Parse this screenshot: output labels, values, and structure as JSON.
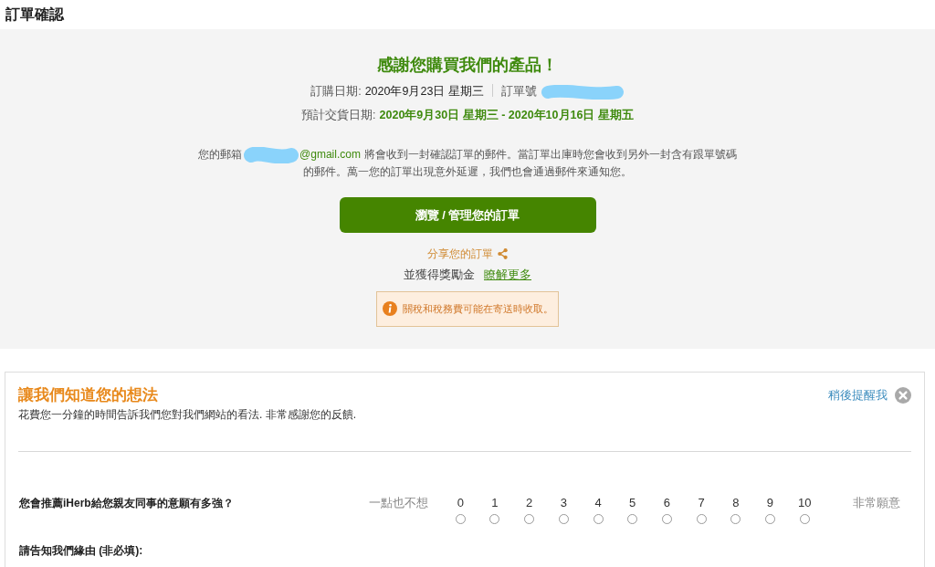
{
  "page_title": "訂單確認",
  "confirmation": {
    "heading": "感謝您購買我們的產品！",
    "order_date_label": "訂購日期:",
    "order_date": "2020年9月23日 星期三",
    "order_number_label": "訂單號",
    "delivery_label": "預計交貨日期:",
    "delivery_range": "2020年9月30日 星期三 - 2020年10月16日 星期五",
    "email_prefix": "您的郵箱",
    "email_domain": "@gmail.com",
    "email_message": "將會收到一封確認訂單的郵件。當訂單出庫時您會收到另外一封含有跟單號碼的郵件。萬一您的訂單出現意外延遲，我們也會通過郵件來通知您。",
    "manage_button": "瀏覽 / 管理您的訂單",
    "share_link": "分享您的訂單",
    "reward_text": "並獲得獎勵金",
    "learn_more_link": "瞭解更多",
    "notice": "關稅和稅務費可能在寄送時收取。"
  },
  "survey": {
    "title": "讓我們知道您的想法",
    "subtitle": "花費您一分鐘的時間告訴我們您對我們網站的看法. 非常感謝您的反饋.",
    "remind_later_link": "稍後提醒我",
    "question": "您會推薦iHerb給您親友同事的意願有多強？",
    "low_label": "一點也不想",
    "high_label": "非常願意",
    "options": [
      {
        "label": "0",
        "selected": false
      },
      {
        "label": "1",
        "selected": false
      },
      {
        "label": "2",
        "selected": false
      },
      {
        "label": "3",
        "selected": false
      },
      {
        "label": "4",
        "selected": false
      },
      {
        "label": "5",
        "selected": false
      },
      {
        "label": "6",
        "selected": false
      },
      {
        "label": "7",
        "selected": false
      },
      {
        "label": "8",
        "selected": false
      },
      {
        "label": "9",
        "selected": false
      },
      {
        "label": "10",
        "selected": false
      }
    ],
    "reason_label": "請告知我們緣由 (非必填):"
  }
}
